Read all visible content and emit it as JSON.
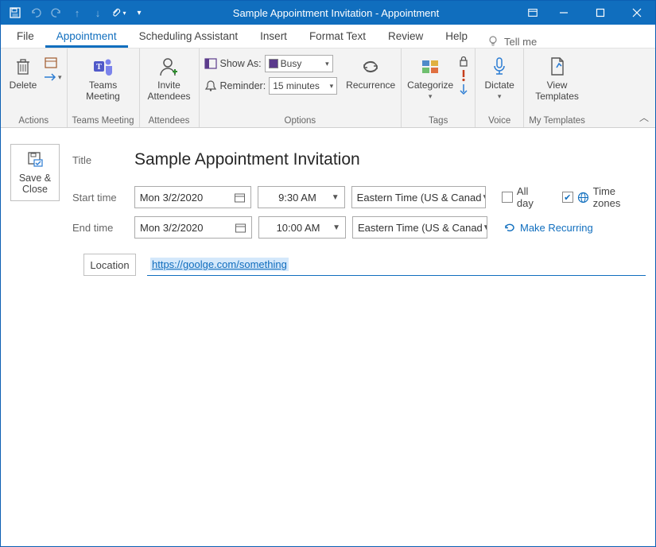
{
  "window": {
    "title": "Sample Appointment Invitation  -  Appointment"
  },
  "tabs": {
    "file": "File",
    "appointment": "Appointment",
    "scheduling": "Scheduling Assistant",
    "insert": "Insert",
    "format": "Format Text",
    "review": "Review",
    "help": "Help",
    "tellme": "Tell me"
  },
  "ribbon": {
    "actions": {
      "delete": "Delete",
      "group": "Actions"
    },
    "teams": {
      "btn": "Teams Meeting",
      "group": "Teams Meeting"
    },
    "attendees": {
      "btn": "Invite Attendees",
      "group": "Attendees"
    },
    "options": {
      "showas_label": "Show As:",
      "showas_value": "Busy",
      "reminder_label": "Reminder:",
      "reminder_value": "15 minutes",
      "recurrence": "Recurrence",
      "group": "Options"
    },
    "tags": {
      "categorize": "Categorize",
      "group": "Tags"
    },
    "voice": {
      "dictate": "Dictate",
      "group": "Voice"
    },
    "templates": {
      "view": "View Templates",
      "group": "My Templates"
    }
  },
  "form": {
    "save_close": "Save & Close",
    "title_label": "Title",
    "title_value": "Sample Appointment Invitation",
    "start_label": "Start time",
    "end_label": "End time",
    "start_date": "Mon 3/2/2020",
    "start_time": "9:30 AM",
    "end_date": "Mon 3/2/2020",
    "end_time": "10:00 AM",
    "tz": "Eastern Time (US & Canad",
    "allday": "All day",
    "timezones": "Time zones",
    "recurring": "Make Recurring",
    "location_label": "Location",
    "location_value": "https://goolge.com/something"
  }
}
